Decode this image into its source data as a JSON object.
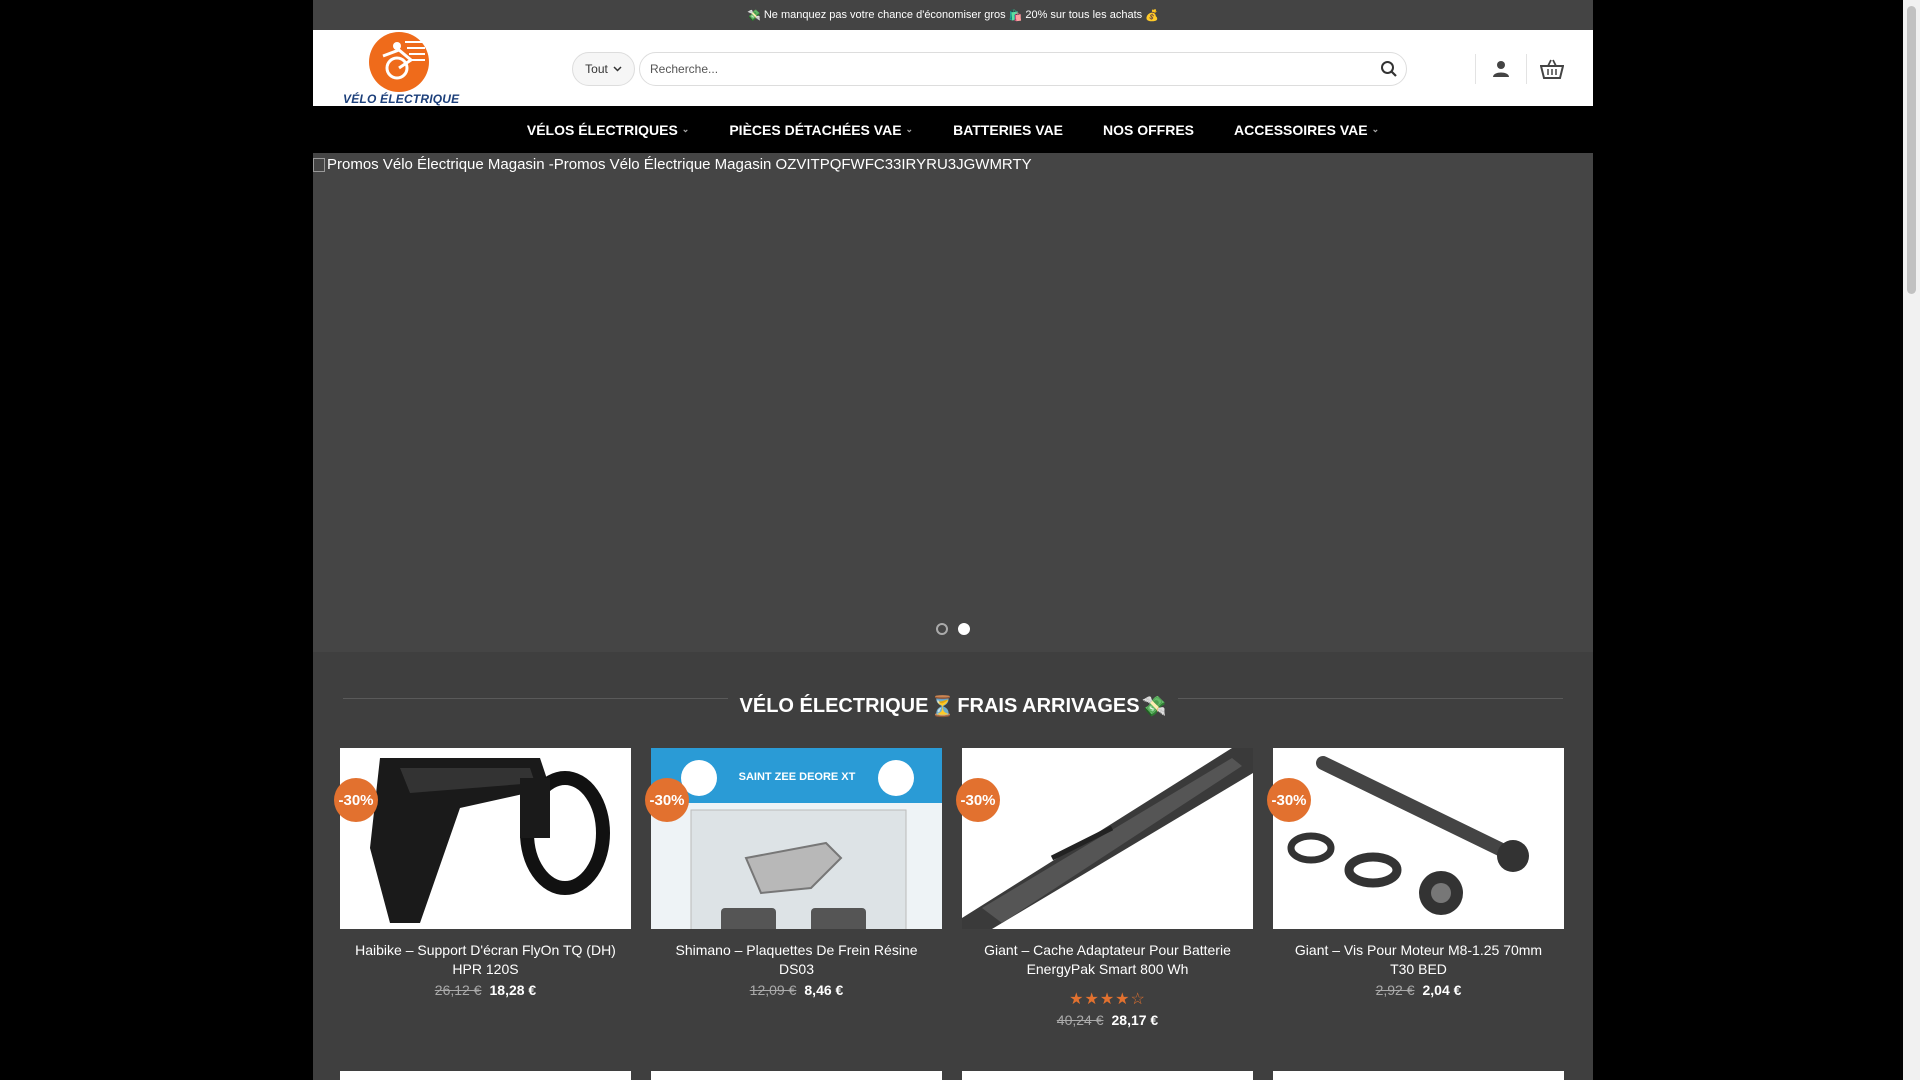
{
  "topbar": {
    "emoji_left": "💸",
    "text_a": "Ne manquez pas votre chance d'économiser gros",
    "emoji_mid": "🛍️",
    "text_b": "20% sur tous les achats",
    "emoji_right": "💰"
  },
  "logo": {
    "text": "VÉLO ÉLECTRIQUE"
  },
  "search": {
    "category": "Tout",
    "placeholder": "Recherche..."
  },
  "nav": [
    {
      "label": "VÉLOS ÉLECTRIQUES",
      "dropdown": true
    },
    {
      "label": "PIÈCES DÉTACHÉES VAE",
      "dropdown": true
    },
    {
      "label": "BATTERIES VAE",
      "dropdown": false
    },
    {
      "label": "NOS OFFRES",
      "dropdown": false
    },
    {
      "label": "ACCESSOIRES VAE",
      "dropdown": true
    }
  ],
  "slider": {
    "alt_text": "Promos Vélo Électrique Magasin -Promos Vélo Électrique Magasin OZVITPQFWFC33IRYRU3JGWMRTY",
    "active_slide": 2,
    "slide_count": 2
  },
  "section": {
    "title": "VÉLO ÉLECTRIQUE",
    "emoji_a": "⏳",
    "title_b": "FRAIS ARRIVAGES",
    "emoji_b": "💸"
  },
  "products": [
    {
      "badge": "-30%",
      "name": "Haibike – Support D'écran FlyOn TQ (DH) HPR 120S",
      "old_price": "26,12 €",
      "new_price": "18,28 €",
      "rating": null
    },
    {
      "badge": "-30%",
      "name": "Shimano – Plaquettes De Frein Résine DS03",
      "old_price": "12,09 €",
      "new_price": "8,46 €",
      "rating": null,
      "package_text": "SAINT ZEE  DEORE XT"
    },
    {
      "badge": "-30%",
      "name": "Giant – Cache Adaptateur Pour Batterie EnergyPak Smart 800 Wh",
      "old_price": "40,24 €",
      "new_price": "28,17 €",
      "rating": 4
    },
    {
      "badge": "-30%",
      "name": "Giant – Vis Pour Moteur M8-1.25 70mm T30 BED",
      "old_price": "2,92 €",
      "new_price": "2,04 €",
      "rating": null
    }
  ],
  "colors": {
    "accent": "#e2712f",
    "nav_bg": "#000000",
    "page_bg": "#3f3f3f",
    "logo_blue": "#1c3f7a"
  },
  "icons": [
    "search-icon",
    "user-icon",
    "basket-icon",
    "chevron-down-icon"
  ]
}
